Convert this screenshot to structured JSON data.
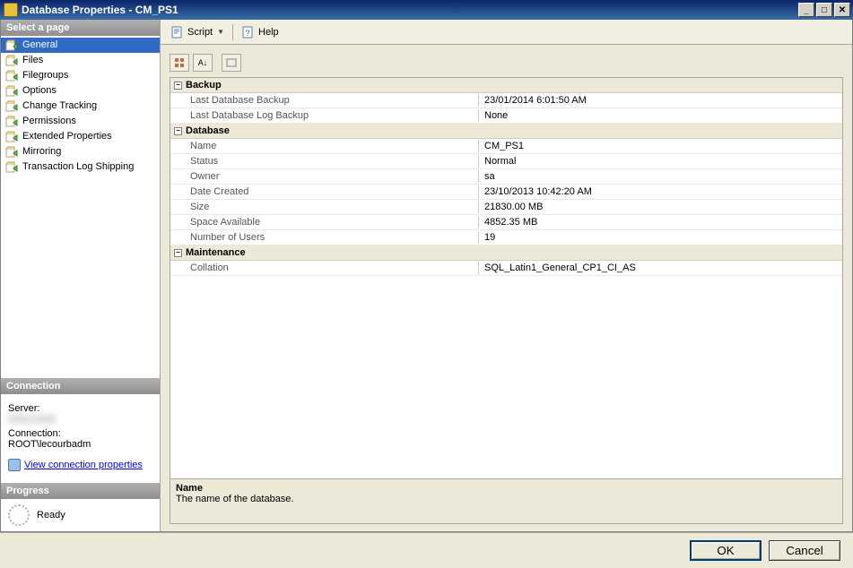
{
  "window": {
    "title": "Database Properties - CM_PS1"
  },
  "winbuttons": {
    "min": "_",
    "max": "□",
    "close": "✕"
  },
  "toolbar": {
    "script_label": "Script",
    "help_label": "Help"
  },
  "left": {
    "selectpage_header": "Select a page",
    "pages": [
      {
        "label": "General",
        "selected": true
      },
      {
        "label": "Files",
        "selected": false
      },
      {
        "label": "Filegroups",
        "selected": false
      },
      {
        "label": "Options",
        "selected": false
      },
      {
        "label": "Change Tracking",
        "selected": false
      },
      {
        "label": "Permissions",
        "selected": false
      },
      {
        "label": "Extended Properties",
        "selected": false
      },
      {
        "label": "Mirroring",
        "selected": false
      },
      {
        "label": "Transaction Log Shipping",
        "selected": false
      }
    ],
    "connection_header": "Connection",
    "server_label": "Server:",
    "server_value": "(obscured)",
    "connection_label": "Connection:",
    "connection_value": "ROOT\\lecourbadm",
    "view_conn_link": "View connection properties",
    "progress_header": "Progress",
    "progress_status": "Ready"
  },
  "propgrid": {
    "sections": [
      {
        "title": "Backup",
        "rows": [
          {
            "key": "Last Database Backup",
            "val": "23/01/2014 6:01:50 AM"
          },
          {
            "key": "Last Database Log Backup",
            "val": "None"
          }
        ]
      },
      {
        "title": "Database",
        "rows": [
          {
            "key": "Name",
            "val": "CM_PS1"
          },
          {
            "key": "Status",
            "val": "Normal"
          },
          {
            "key": "Owner",
            "val": "sa"
          },
          {
            "key": "Date Created",
            "val": "23/10/2013 10:42:20 AM"
          },
          {
            "key": "Size",
            "val": "21830.00 MB"
          },
          {
            "key": "Space Available",
            "val": "4852.35 MB"
          },
          {
            "key": "Number of Users",
            "val": "19"
          }
        ]
      },
      {
        "title": "Maintenance",
        "rows": [
          {
            "key": "Collation",
            "val": "SQL_Latin1_General_CP1_CI_AS"
          }
        ]
      }
    ],
    "desc_title": "Name",
    "desc_text": "The name of the database."
  },
  "buttons": {
    "ok": "OK",
    "cancel": "Cancel"
  }
}
